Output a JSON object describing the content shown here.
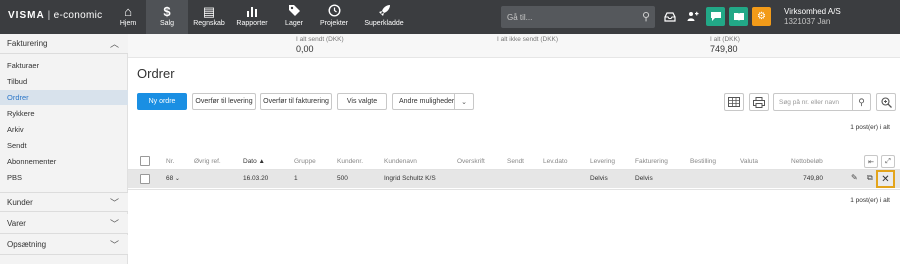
{
  "app": {
    "logo_brand": "VISMA",
    "logo_product": "e-conomic"
  },
  "nav": {
    "items": [
      {
        "label": "Hjem",
        "icon": "home-icon"
      },
      {
        "label": "Salg",
        "icon": "dollar-icon"
      },
      {
        "label": "Regnskab",
        "icon": "ledger-icon"
      },
      {
        "label": "Rapporter",
        "icon": "bar-chart-icon"
      },
      {
        "label": "Lager",
        "icon": "tag-icon"
      },
      {
        "label": "Projekter",
        "icon": "clock-icon"
      },
      {
        "label": "Superkladde",
        "icon": "rocket-icon"
      }
    ],
    "active": "Salg"
  },
  "topsearch": {
    "placeholder": "Gå til..."
  },
  "company": {
    "name": "Virksomhed A/S",
    "id_user": "1321037 Jan"
  },
  "colors": {
    "topbar": "#3b3d40",
    "primary": "#1a8fe3",
    "green": "#22a887",
    "orange": "#f29b19",
    "highlight": "#e3a41b"
  },
  "sidebar": {
    "sections": [
      {
        "label": "Fakturering",
        "expanded": true,
        "items": [
          "Fakturaer",
          "Tilbud",
          "Ordrer",
          "Rykkere",
          "Arkiv",
          "Sendt",
          "Abonnementer",
          "PBS"
        ],
        "active": "Ordrer"
      },
      {
        "label": "Kunder",
        "expanded": false
      },
      {
        "label": "Varer",
        "expanded": false
      },
      {
        "label": "Opsætning",
        "expanded": false
      }
    ]
  },
  "totals": [
    {
      "label": "I alt sendt (DKK)",
      "value": "0,00"
    },
    {
      "label": "I alt ikke sendt (DKK)",
      "value": ""
    },
    {
      "label": "I alt (DKK)",
      "value": "749,80"
    }
  ],
  "page": {
    "title": "Ordrer"
  },
  "toolbar": {
    "new_order": "Ny ordre",
    "transfer_delivery": "Overfør til levering",
    "transfer_invoicing": "Overfør til fakturering",
    "show_selected": "Vis valgte",
    "other_options": "Andre muligheder",
    "search_placeholder": "Søg på nr. eller navn"
  },
  "count_label": "1 post(er) i alt",
  "table": {
    "columns": [
      "Nr.",
      "Øvrig ref.",
      "Dato",
      "Gruppe",
      "Kundenr.",
      "Kundenavn",
      "Overskrift",
      "Sendt",
      "Lev.dato",
      "Levering",
      "Fakturering",
      "Bestilling",
      "Valuta",
      "Nettobeløb"
    ],
    "sorted_column": "Dato",
    "sort_direction": "asc",
    "rows": [
      {
        "nr": "68",
        "ref": "",
        "dato": "16.03.20",
        "gruppe": "1",
        "kundenr": "500",
        "kundenavn": "Ingrid Schultz K/S",
        "overskrift": "",
        "sendt": "",
        "levdato": "",
        "levering": "Delvis",
        "fakturering": "Delvis",
        "bestilling": "",
        "valuta": "",
        "nettobelob": "749,80"
      }
    ]
  }
}
